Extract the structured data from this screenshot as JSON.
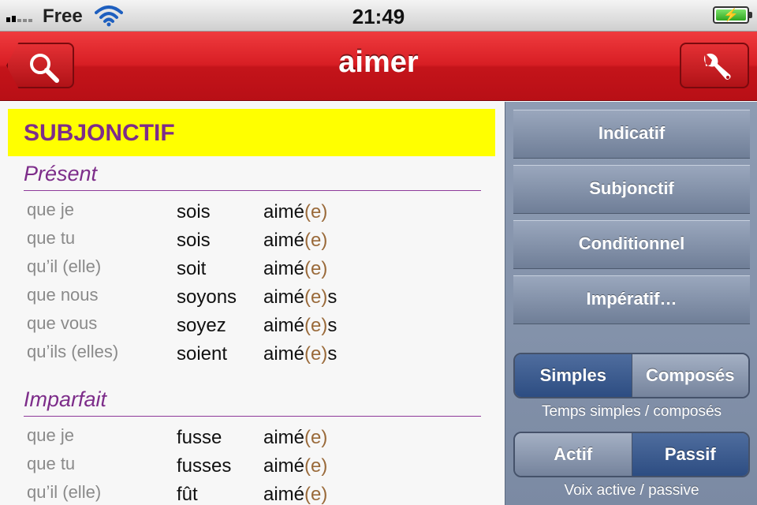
{
  "status_bar": {
    "carrier": "Free",
    "time": "21:49",
    "signal_icon": "signal-bars-icon",
    "wifi_icon": "wifi-icon",
    "battery_icon": "battery-charging-icon"
  },
  "nav": {
    "title": "aimer",
    "left_icon": "search-icon",
    "right_icon": "wrench-icon"
  },
  "mood": {
    "title": "SUBJONCTIF"
  },
  "tenses": [
    {
      "name": "Présent",
      "rows": [
        {
          "pronoun": "que je",
          "aux": "sois",
          "participle": "aimé",
          "ending": "(e)",
          "plural": ""
        },
        {
          "pronoun": "que tu",
          "aux": "sois",
          "participle": "aimé",
          "ending": "(e)",
          "plural": ""
        },
        {
          "pronoun": "qu’il (elle)",
          "aux": "soit",
          "participle": "aimé",
          "ending": "(e)",
          "plural": ""
        },
        {
          "pronoun": "que nous",
          "aux": "soyons",
          "participle": "aimé",
          "ending": "(e)",
          "plural": "s"
        },
        {
          "pronoun": "que vous",
          "aux": "soyez",
          "participle": "aimé",
          "ending": "(e)",
          "plural": "s"
        },
        {
          "pronoun": "qu’ils (elles)",
          "aux": "soient",
          "participle": "aimé",
          "ending": "(e)",
          "plural": "s"
        }
      ]
    },
    {
      "name": "Imparfait",
      "rows": [
        {
          "pronoun": "que je",
          "aux": "fusse",
          "participle": "aimé",
          "ending": "(e)",
          "plural": ""
        },
        {
          "pronoun": "que tu",
          "aux": "fusses",
          "participle": "aimé",
          "ending": "(e)",
          "plural": ""
        },
        {
          "pronoun": "qu’il (elle)",
          "aux": "fût",
          "participle": "aimé",
          "ending": "(e)",
          "plural": ""
        }
      ]
    }
  ],
  "panel": {
    "moods": [
      "Indicatif",
      "Subjonctif",
      "Conditionnel",
      "Impératif…"
    ],
    "tense_toggle": {
      "options": [
        "Simples",
        "Composés"
      ],
      "selected": "Simples",
      "caption": "Temps simples / composés"
    },
    "voice_toggle": {
      "options": [
        "Actif",
        "Passif"
      ],
      "selected": "Passif",
      "caption": "Voix active / passive"
    }
  },
  "colors": {
    "nav_red": "#d81e24",
    "mood_highlight": "#ffff00",
    "accent_purple": "#7d2d8a",
    "ending_brown": "#9a6a3a",
    "panel_blue": "#7b8aa3",
    "selected_blue": "#2d4d82"
  }
}
